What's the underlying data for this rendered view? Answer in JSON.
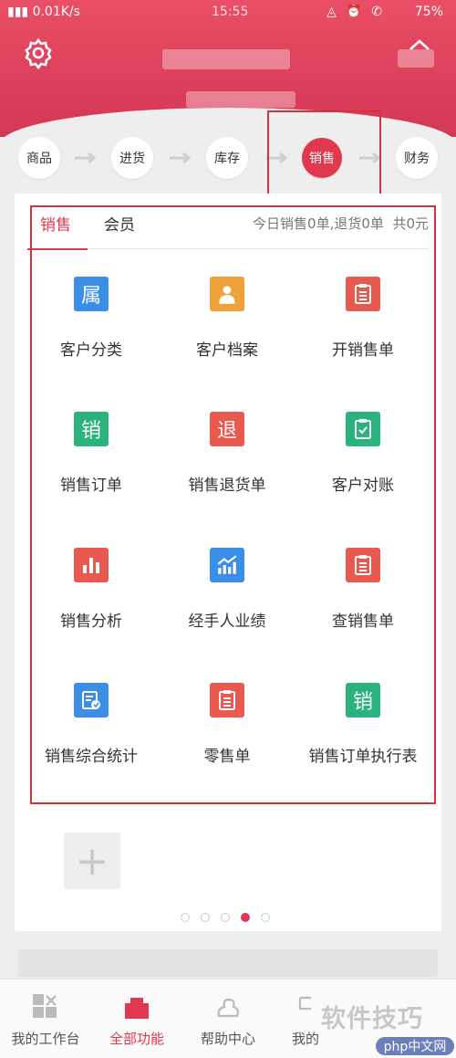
{
  "status_bar": {
    "network": "0.01K/s",
    "time": "15:55",
    "battery": "75%"
  },
  "flow": {
    "steps": [
      {
        "label": "商品"
      },
      {
        "label": "进货"
      },
      {
        "label": "库存"
      },
      {
        "label": "销售"
      },
      {
        "label": "财务"
      }
    ],
    "active": "销售"
  },
  "tabs": [
    {
      "label": "销售"
    },
    {
      "label": "会员"
    }
  ],
  "summary": {
    "today_sales": "今日销售0单",
    "returns": ",退货0单",
    "total": "共0元"
  },
  "grid": [
    {
      "label": "客户分类",
      "icon": "属",
      "icon_name": "category-icon",
      "color": "#3a8ee6"
    },
    {
      "label": "客户档案",
      "icon": "",
      "icon_name": "customer-profile-icon",
      "color": "#f0a23a"
    },
    {
      "label": "开销售单",
      "icon": "",
      "icon_name": "clipboard-icon",
      "color": "#e85a4f"
    },
    {
      "label": "销售订单",
      "icon": "销",
      "icon_name": "sales-order-icon",
      "color": "#2bb37d"
    },
    {
      "label": "销售退货单",
      "icon": "退",
      "icon_name": "return-icon",
      "color": "#e85a4f"
    },
    {
      "label": "客户对账",
      "icon": "",
      "icon_name": "checklist-icon",
      "color": "#2bb37d"
    },
    {
      "label": "销售分析",
      "icon": "",
      "icon_name": "bar-chart-icon",
      "color": "#e85a4f"
    },
    {
      "label": "经手人业绩",
      "icon": "",
      "icon_name": "growth-chart-icon",
      "color": "#3a8ee6"
    },
    {
      "label": "查销售单",
      "icon": "",
      "icon_name": "clipboard-icon",
      "color": "#e85a4f"
    },
    {
      "label": "销售综合统计",
      "icon": "",
      "icon_name": "stats-icon",
      "color": "#3a8ee6"
    },
    {
      "label": "零售单",
      "icon": "",
      "icon_name": "clipboard-icon",
      "color": "#e85a4f"
    },
    {
      "label": "销售订单执行表",
      "icon": "销",
      "icon_name": "sales-order-icon",
      "color": "#2bb37d"
    }
  ],
  "pagination": {
    "total": 5,
    "active": 4
  },
  "bottom_nav": [
    {
      "label": "我的工作台",
      "icon_name": "workbench-icon"
    },
    {
      "label": "全部功能",
      "icon_name": "all-functions-icon"
    },
    {
      "label": "帮助中心",
      "icon_name": "help-icon"
    },
    {
      "label": "我的",
      "icon_name": "me-icon"
    }
  ],
  "watermark": {
    "text": "软件技巧",
    "logo": "php中文网"
  },
  "colors": {
    "brand": "#e0384f",
    "highlight_box": "#d1333f"
  }
}
